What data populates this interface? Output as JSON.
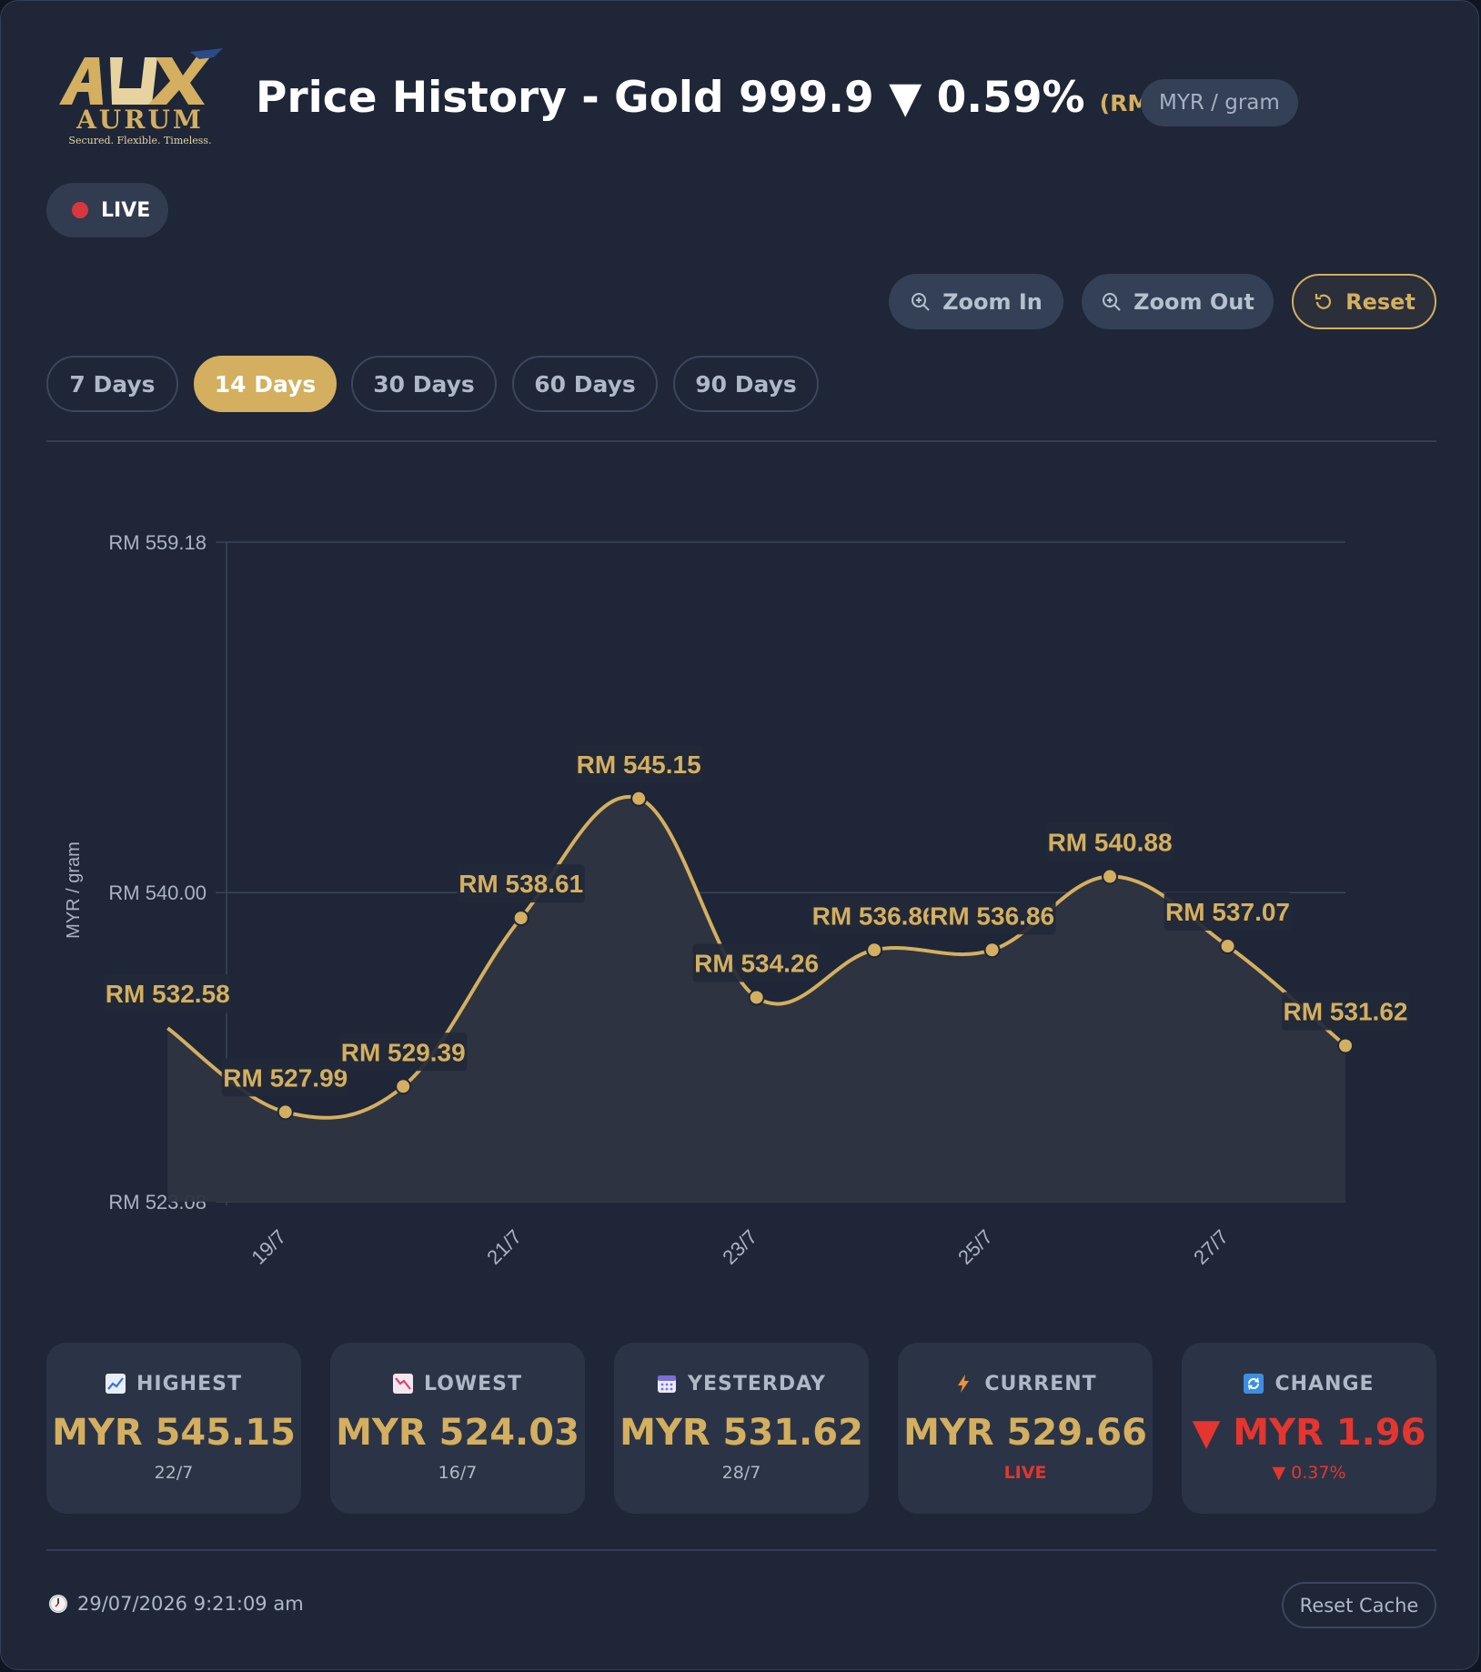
{
  "header": {
    "logo": {
      "wordmark": "AUX",
      "brand": "AURUM",
      "tagline": "Secured. Flexible. Timeless."
    },
    "title": "Price History - Gold 999.9 ▼ 0.59%",
    "price": "(RM 531.62)",
    "unit": "MYR / gram",
    "live_label": "LIVE"
  },
  "toolbar": {
    "zoom_in": "Zoom In",
    "zoom_out": "Zoom Out",
    "reset": "Reset"
  },
  "tabs": [
    {
      "label": "7 Days",
      "active": false
    },
    {
      "label": "14 Days",
      "active": true
    },
    {
      "label": "30 Days",
      "active": false
    },
    {
      "label": "60 Days",
      "active": false
    },
    {
      "label": "90 Days",
      "active": false
    }
  ],
  "chart_data": {
    "type": "area",
    "ylabel": "MYR / gram",
    "yticks": [
      {
        "value": 559.18,
        "label": "RM 559.18"
      },
      {
        "value": 540.0,
        "label": "RM 540.00"
      },
      {
        "value": 523.08,
        "label": "RM 523.08"
      }
    ],
    "ylim": [
      523.08,
      559.18
    ],
    "xlim": [
      18.5,
      28.0
    ],
    "xticks": [
      {
        "x": 19,
        "label": "19/7"
      },
      {
        "x": 21,
        "label": "21/7"
      },
      {
        "x": 23,
        "label": "23/7"
      },
      {
        "x": 25,
        "label": "25/7"
      },
      {
        "x": 27,
        "label": "27/7"
      }
    ],
    "points": [
      {
        "x": 18,
        "y": 532.58,
        "label": "RM 532.58"
      },
      {
        "x": 19,
        "y": 527.99,
        "label": "RM 527.99"
      },
      {
        "x": 20,
        "y": 529.39,
        "label": "RM 529.39"
      },
      {
        "x": 21,
        "y": 538.61,
        "label": "RM 538.61"
      },
      {
        "x": 22,
        "y": 545.15,
        "label": "RM 545.15"
      },
      {
        "x": 23,
        "y": 534.26,
        "label": "RM 534.26"
      },
      {
        "x": 24,
        "y": 536.86,
        "label": "RM 536.86"
      },
      {
        "x": 25,
        "y": 536.86,
        "label": "RM 536.86"
      },
      {
        "x": 26,
        "y": 540.88,
        "label": "RM 540.88"
      },
      {
        "x": 27,
        "y": 537.07,
        "label": "RM 537.07"
      },
      {
        "x": 28,
        "y": 531.62,
        "label": "RM 531.62"
      }
    ],
    "colors": {
      "line": "#d3af5f",
      "fill": "#2e3440",
      "grid": "#3a4558",
      "label_bg": "#222838"
    }
  },
  "stats": [
    {
      "icon": "chart-up-icon",
      "label": "HIGHEST",
      "value": "MYR 545.15",
      "sub": "22/7"
    },
    {
      "icon": "chart-down-icon",
      "label": "LOWEST",
      "value": "MYR 524.03",
      "sub": "16/7"
    },
    {
      "icon": "calendar-icon",
      "label": "YESTERDAY",
      "value": "MYR 531.62",
      "sub": "28/7"
    },
    {
      "icon": "lightning-icon",
      "label": "CURRENT",
      "value": "MYR 529.66",
      "sub": "LIVE"
    },
    {
      "icon": "refresh-icon",
      "label": "CHANGE",
      "value": "▼ MYR 1.96",
      "sub": "▼ 0.37%"
    }
  ],
  "footer": {
    "timestamp": "29/07/2026 9:21:09 am",
    "reset_cache": "Reset Cache"
  },
  "colors": {
    "gold": "#d3af5f",
    "negative": "#e5352f",
    "background": "#1e2638"
  }
}
